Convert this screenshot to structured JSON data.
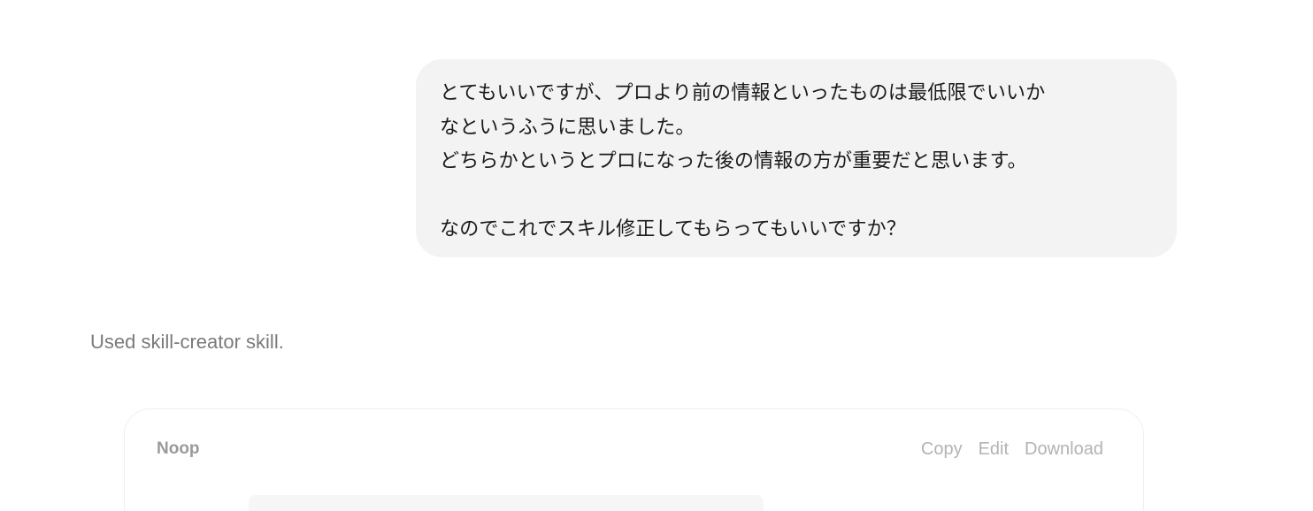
{
  "user_message": {
    "lines": [
      "とてもいいですが、プロより前の情報といったものは最低限でいいか",
      "なというふうに思いました。",
      "どちらかというとプロになった後の情報の方が重要だと思います。",
      "",
      "なのでこれでスキル修正してもらってもいいですか？"
    ]
  },
  "status": {
    "text": "Used skill-creator skill."
  },
  "artifact": {
    "title": "Noop",
    "actions": {
      "copy": "Copy",
      "edit": "Edit",
      "download": "Download"
    }
  }
}
